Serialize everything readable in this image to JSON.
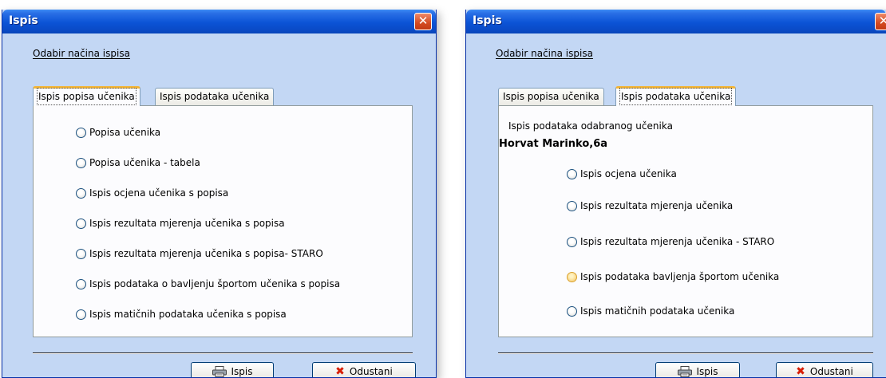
{
  "colors": {
    "window_bg": "#c3d7f4",
    "title_bar": "#0b53d6",
    "tab_highlight": "#f3b538",
    "close_red": "#d34a21"
  },
  "left_window": {
    "title": "Ispis",
    "section_label": "Odabir načina ispisa",
    "tabs": [
      {
        "label": "Ispis popisa učenika",
        "active": true
      },
      {
        "label": "Ispis podataka učenika",
        "active": false
      }
    ],
    "options": [
      "Popisa učenika",
      "Popisa učenika - tabela",
      "Ispis ocjena učenika s popisa",
      "Ispis rezultata mjerenja učenika s popisa",
      "Ispis rezultata mjerenja učenika s popisa- STARO",
      "Ispis podataka o bavljenju športom učenika s popisa",
      "Ispis matičnih podataka učenika s popisa"
    ],
    "print_button": "Ispis",
    "cancel_button": "Odustani"
  },
  "right_window": {
    "title": "Ispis",
    "section_label": "Odabir načina ispisa",
    "tabs": [
      {
        "label": "Ispis popisa učenika",
        "active": false
      },
      {
        "label": "Ispis podataka učenika",
        "active": true
      }
    ],
    "info_text": "Ispis podataka odabranog učenika",
    "student_name": "Horvat Marinko,6a",
    "options": [
      "Ispis ocjena učenika",
      "Ispis rezultata mjerenja učenika",
      "Ispis rezultata mjerenja učenika - STARO",
      "Ispis podataka bavljenja športom učenika",
      "Ispis matičnih podataka učenika"
    ],
    "hovered_option": "Ispis podataka bavljenja športom učenika",
    "print_button": "Ispis",
    "cancel_button": "Odustani"
  },
  "icons": {
    "close": "close-icon",
    "printer": "printer-icon",
    "cancel": "x-icon",
    "radio": "radio-icon"
  }
}
